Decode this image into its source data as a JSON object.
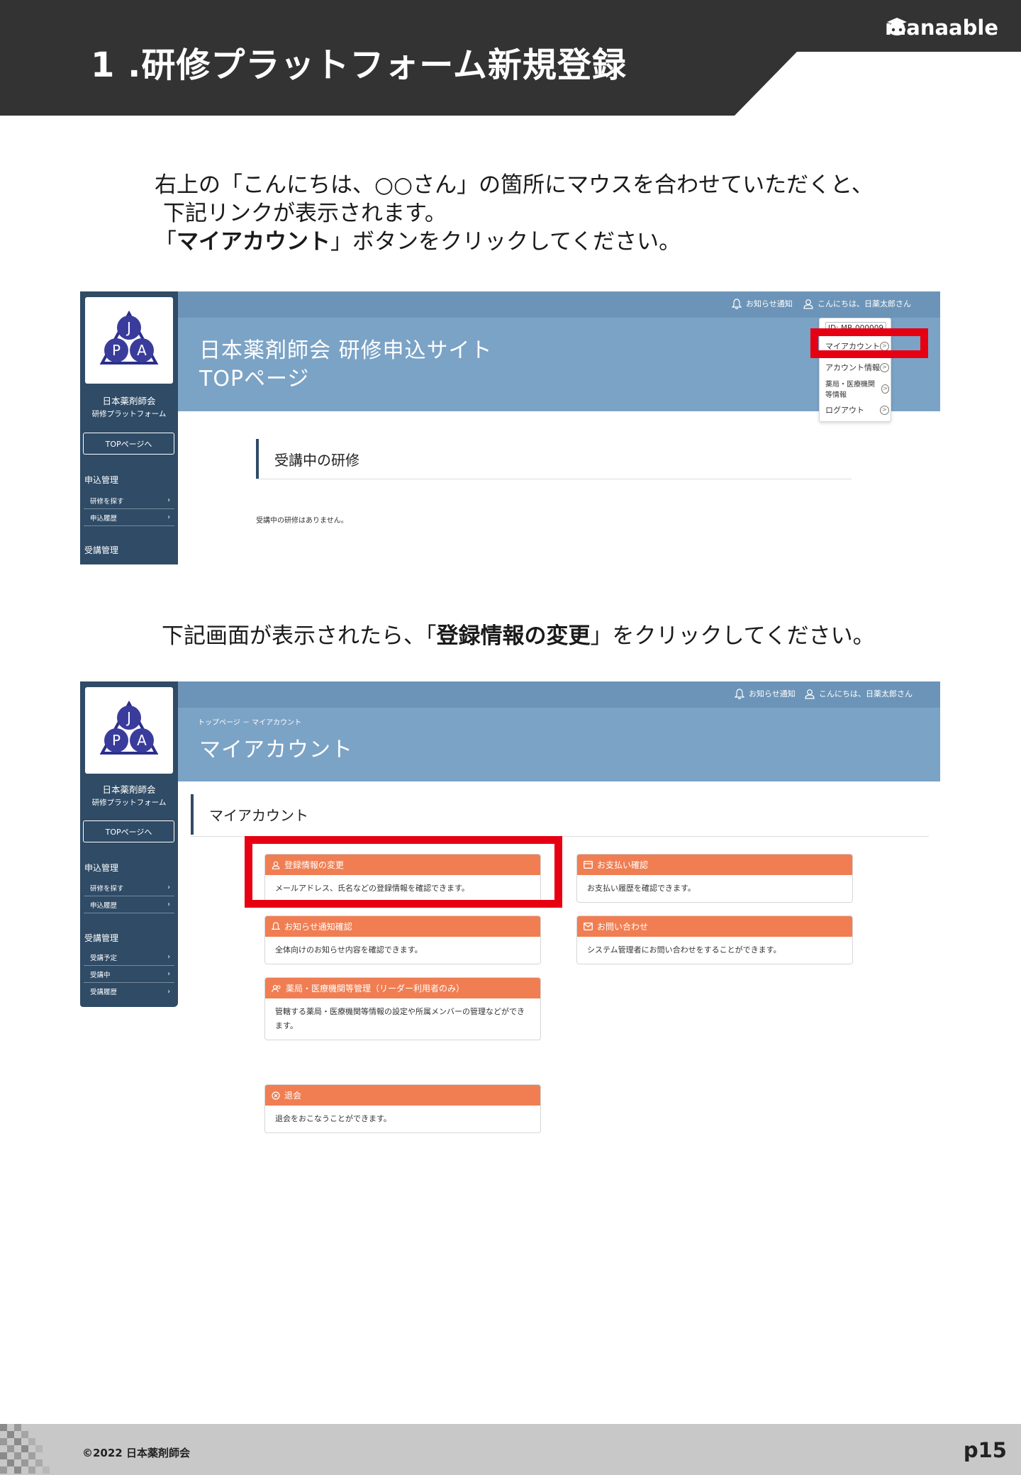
{
  "header": {
    "title": "1 .研修プラットフォーム新規登録",
    "brand": "manaable"
  },
  "step1": {
    "line1": "右上の「こんにちは、○○さん」の箇所にマウスを合わせていただくと、",
    "line2": "下記リンクが表示されます。",
    "line3_open": "「",
    "line3_bold": "マイアカウント",
    "line3_rest": "」ボタンをクリックしてください。"
  },
  "step2": {
    "prefix": "下記画面が表示されたら、「",
    "bold": "登録情報の変更",
    "suffix": "」をクリックしてください。"
  },
  "mock_common": {
    "logo_letters": [
      "J",
      "P",
      "A"
    ],
    "org_name": "日本薬剤師会",
    "org_sub": "研修プラットフォーム",
    "top_button": "TOPページへ",
    "section_apply": "申込管理",
    "item_search": "研修を探す",
    "item_history": "申込履歴",
    "section_course": "受講管理",
    "notice_link": "お知らせ通知",
    "greeting": "こんにちは、日薬太郎さん",
    "chevron": "›"
  },
  "mock1": {
    "hero_title_1": "日本薬剤師会 研修申込サイト",
    "hero_title_2": "TOPページ",
    "section_title": "受講中の研修",
    "empty_text": "受講中の研修はありません。",
    "dropdown": {
      "id_label": "ID: MB-000009",
      "items": [
        "マイアカウント",
        "アカウント情報",
        "薬局・医療機関等情報",
        "ログアウト"
      ],
      "arrow": ">"
    }
  },
  "mock2": {
    "breadcrumb": "トップページ － マイアカウント",
    "hero_title": "マイアカウント",
    "section_title": "マイアカウント",
    "course_items": [
      "受講予定",
      "受講中",
      "受講履歴"
    ],
    "cards": [
      {
        "title": "登録情報の変更",
        "body": "メールアドレス、氏名などの登録情報を確認できます。",
        "icon": "user-icon"
      },
      {
        "title": "お支払い確認",
        "body": "お支払い履歴を確認できます。",
        "icon": "card-icon"
      },
      {
        "title": "お知らせ通知確認",
        "body": "全体向けのお知らせ内容を確認できます。",
        "icon": "bell-icon"
      },
      {
        "title": "お問い合わせ",
        "body": "システム管理者にお問い合わせをすることができます。",
        "icon": "mail-icon"
      },
      {
        "title": "薬局・医療機関等管理（リーダー利用者のみ）",
        "body": "管轄する薬局・医療機関等情報の設定や所属メンバーの管理などができます。",
        "icon": "group-icon"
      },
      {
        "title": "退会",
        "body": "退会をおこなうことができます。",
        "icon": "close-circle-icon"
      }
    ]
  },
  "footer": {
    "copyright": "©2022 日本薬剤師会",
    "page": "p15"
  },
  "colors": {
    "banner": "#333333",
    "sidebar": "#2f4b66",
    "hero": "#7ba3c6",
    "card_header": "#f07e52",
    "highlight": "#e60012"
  }
}
